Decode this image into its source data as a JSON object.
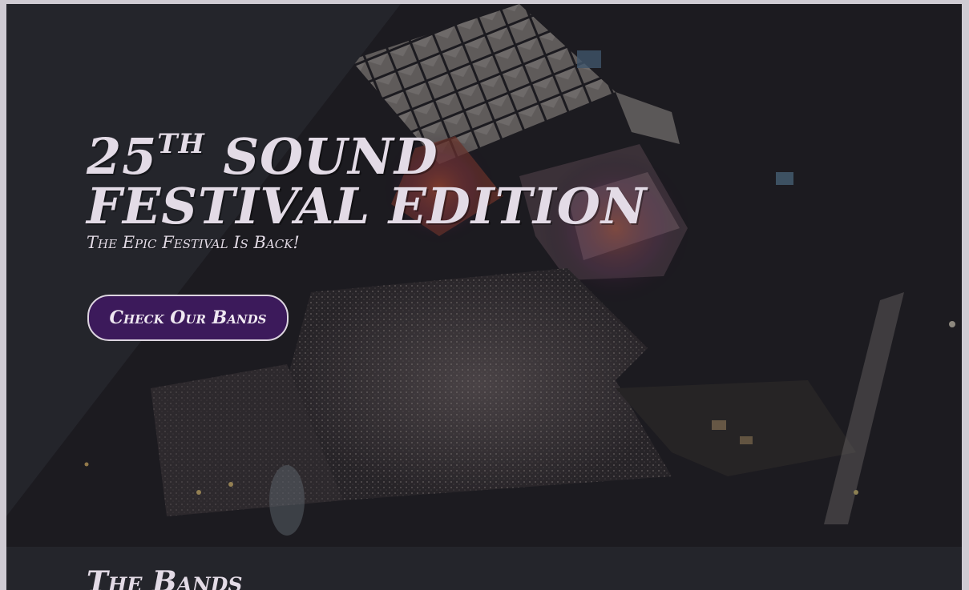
{
  "hero": {
    "title_number": "25",
    "title_suffix": "th",
    "title_line1_rest": "sound",
    "title_line2": "festival edition",
    "subtitle": "The Epic Festival Is Back!",
    "cta_label": "Check Our Bands",
    "image": "aerial-festival-crowd-at-night"
  },
  "sections": {
    "bands_heading": "The Bands"
  },
  "colors": {
    "background": "#24252b",
    "text": "#e3dbe6",
    "button": "#3c1a5b",
    "button_border": "#ddd5e0",
    "page_border": "#cfcbd3"
  }
}
